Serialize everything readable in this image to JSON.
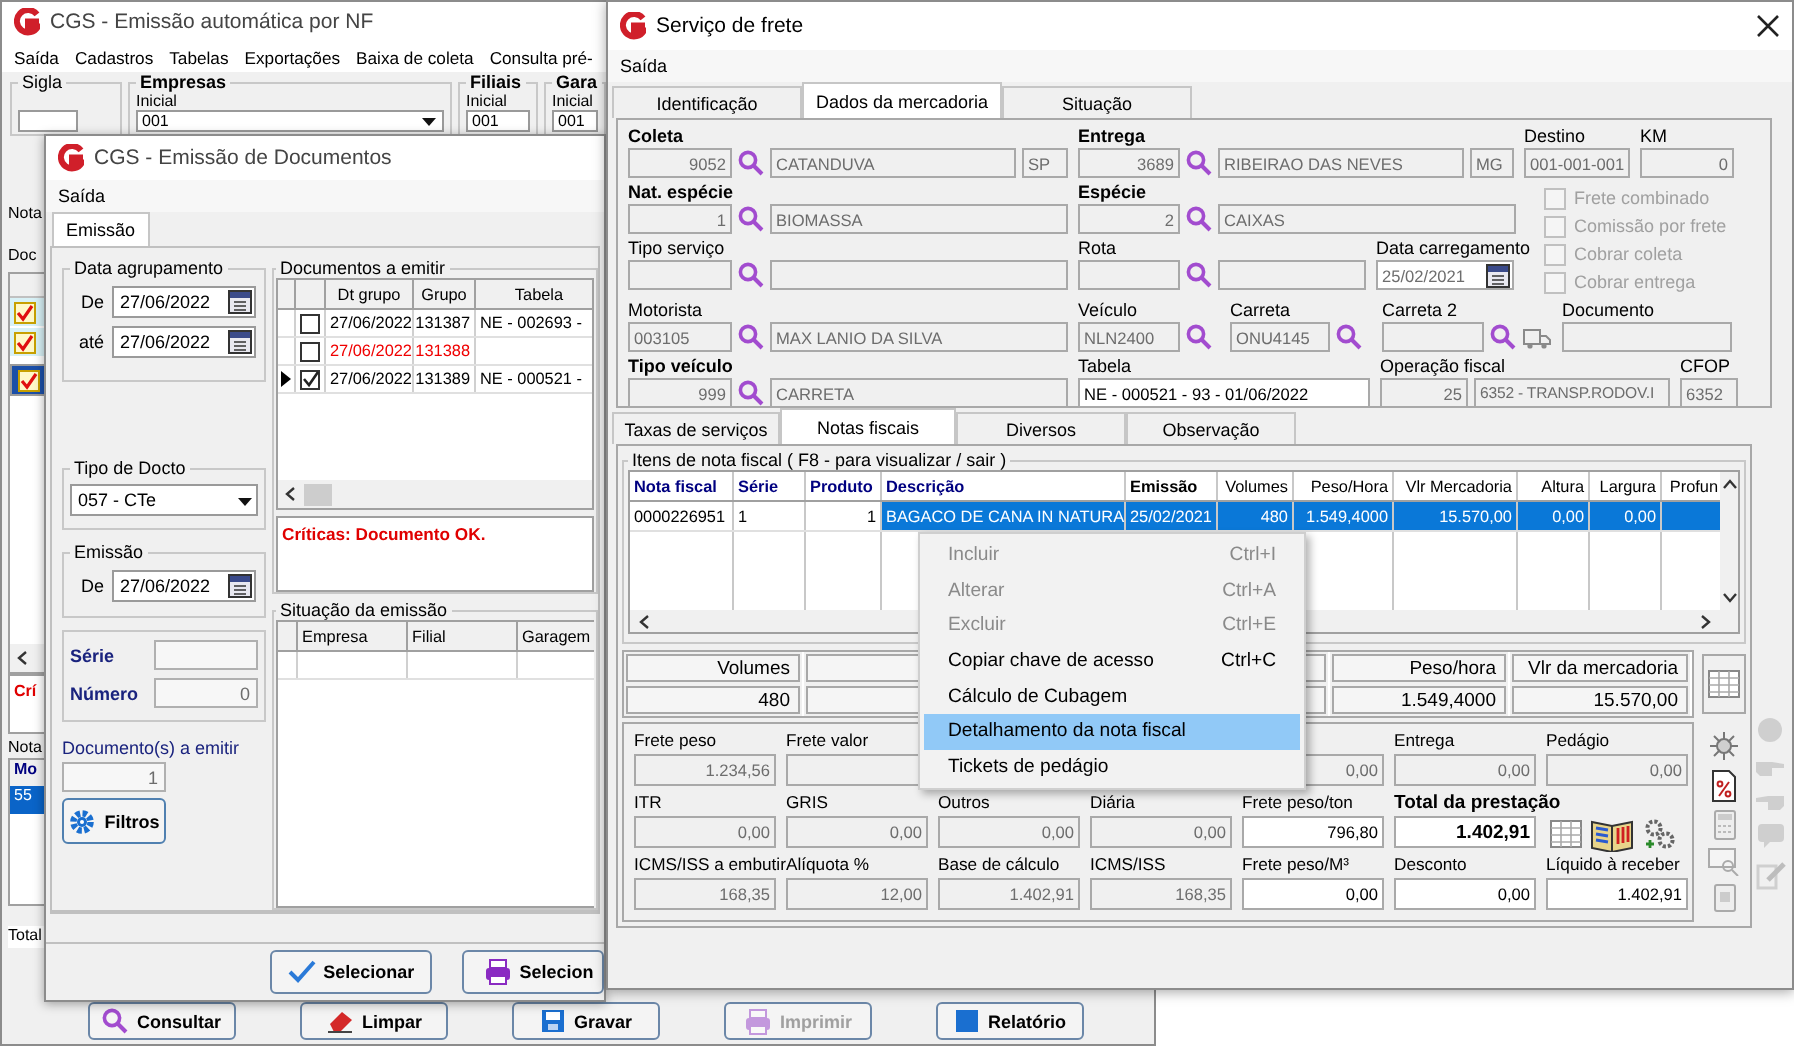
{
  "back_window": {
    "title": "CGS - Emissão automática por NF",
    "menu": [
      "Saída",
      "Cadastros",
      "Tabelas",
      "Exportações",
      "Baixa de coleta",
      "Consulta pré-"
    ],
    "filters": [
      {
        "label": "Sigla",
        "kind": "plain"
      },
      {
        "label": "Empresas",
        "kind": "select",
        "sublabel": "Inicial",
        "value": "001"
      },
      {
        "label": "Filiais",
        "kind": "text",
        "sublabel": "Inicial",
        "value": "001"
      },
      {
        "label": "Gara",
        "kind": "text",
        "sublabel": "Inicial",
        "value": "001"
      }
    ],
    "tab": "Nota",
    "grid_title": "Doc",
    "checks": [
      {
        "checked": true,
        "selected": false
      },
      {
        "checked": true,
        "selected": false
      },
      {
        "checked": true,
        "selected": true
      }
    ],
    "criticas": "Crí",
    "notes_title": "Nota",
    "notes_header": "Mo",
    "notes_cell": "55",
    "total_label": "Total",
    "buttons": [
      {
        "label": "Consultar",
        "disabled": false
      },
      {
        "label": "Limpar",
        "disabled": false
      },
      {
        "label": "Gravar",
        "disabled": false
      },
      {
        "label": "Imprimir",
        "disabled": true
      },
      {
        "label": "Relatório",
        "disabled": false
      }
    ]
  },
  "documents_window": {
    "title": "CGS - Emissão de Documentos",
    "menu": [
      "Saída"
    ],
    "tabs": [
      {
        "label": "Emissão",
        "selected": true
      }
    ],
    "date_group": {
      "title": "Data agrupamento",
      "from_label": "De",
      "from": "27/06/2022",
      "to_label": "até",
      "to": "27/06/2022"
    },
    "doc_type": {
      "title": "Tipo de Docto",
      "value": "057 - CTe"
    },
    "emission": {
      "title": "Emissão",
      "from_label": "De",
      "from": "27/06/2022"
    },
    "serie_label": "Série",
    "numero_label": "Número",
    "numero": "0",
    "count_label": "Documento(s) a emitir",
    "count": "1",
    "filters_button": "Filtros",
    "docs": {
      "title": "Documentos a emitir",
      "columns": [
        "Dt grupo",
        "Grupo",
        "Tabela"
      ],
      "rows": [
        {
          "checked": false,
          "current": false,
          "error": false,
          "cells": [
            "27/06/2022",
            "131387",
            "NE - 002693 -"
          ]
        },
        {
          "checked": false,
          "current": false,
          "error": true,
          "cells": [
            "27/06/2022",
            "131388",
            ""
          ]
        },
        {
          "checked": true,
          "current": true,
          "error": false,
          "cells": [
            "27/06/2022",
            "131389",
            "NE - 000521 -"
          ]
        }
      ]
    },
    "criticas": "Críticas: Documento OK.",
    "status": {
      "title": "Situação da emissão",
      "columns": [
        "Empresa",
        "Filial",
        "Garagem"
      ]
    },
    "buttons": [
      "Selecionar",
      "Selecion"
    ]
  },
  "freight_window": {
    "title": "Serviço de frete",
    "menu": [
      "Saída"
    ],
    "tabs": [
      {
        "label": "Identificação",
        "selected": false
      },
      {
        "label": "Dados da mercadoria",
        "selected": true
      },
      {
        "label": "Situação",
        "selected": false
      }
    ],
    "form": [
      [
        {
          "label": "Coleta",
          "bold": true,
          "parts": [
            {
              "kind": "code",
              "value": "9052"
            },
            {
              "kind": "lookup"
            },
            {
              "kind": "text",
              "value": "CATANDUVA"
            },
            {
              "kind": "text",
              "value": "SP"
            }
          ]
        },
        {
          "label": "Entrega",
          "bold": true,
          "parts": [
            {
              "kind": "code",
              "value": "3689"
            },
            {
              "kind": "lookup"
            },
            {
              "kind": "text",
              "value": "RIBEIRAO DAS NEVES"
            },
            {
              "kind": "text",
              "value": "MG"
            }
          ]
        },
        {
          "label": "Destino",
          "bold": false,
          "parts": [
            {
              "kind": "text",
              "value": "001-001-001"
            }
          ]
        },
        {
          "label": "KM",
          "bold": false,
          "parts": [
            {
              "kind": "code",
              "value": "0"
            }
          ]
        }
      ],
      [
        {
          "label": "Nat. espécie",
          "bold": true,
          "parts": [
            {
              "kind": "code",
              "value": "1"
            },
            {
              "kind": "lookup"
            },
            {
              "kind": "text",
              "value": "BIOMASSA"
            }
          ]
        },
        {
          "label": "Espécie",
          "bold": true,
          "parts": [
            {
              "kind": "code",
              "value": "2"
            },
            {
              "kind": "lookup"
            },
            {
              "kind": "text",
              "value": "CAIXAS"
            }
          ]
        }
      ],
      [
        {
          "label": "Tipo serviço",
          "bold": false,
          "parts": [
            {
              "kind": "code"
            },
            {
              "kind": "lookup"
            },
            {
              "kind": "text"
            }
          ]
        },
        {
          "label": "Rota",
          "bold": false,
          "parts": [
            {
              "kind": "code"
            },
            {
              "kind": "lookup"
            },
            {
              "kind": "text"
            }
          ]
        },
        {
          "label": "Data carregamento",
          "bold": false,
          "parts": [
            {
              "kind": "date",
              "value": "25/02/2021"
            }
          ]
        }
      ],
      [
        {
          "label": "Motorista",
          "bold": false,
          "parts": [
            {
              "kind": "text",
              "value": "003105"
            },
            {
              "kind": "lookup"
            },
            {
              "kind": "text",
              "value": "MAX LANIO DA SILVA"
            }
          ]
        },
        {
          "label": "Veículo",
          "bold": false,
          "parts": [
            {
              "kind": "text",
              "value": "NLN2400"
            },
            {
              "kind": "lookup"
            }
          ]
        },
        {
          "label": "Carreta",
          "bold": false,
          "parts": [
            {
              "kind": "text",
              "value": "ONU4145"
            },
            {
              "kind": "lookup"
            }
          ]
        },
        {
          "label": "Carreta 2",
          "bold": false,
          "parts": [
            {
              "kind": "text"
            },
            {
              "kind": "lookup"
            },
            {
              "kind": "truck"
            }
          ]
        },
        {
          "label": "Documento",
          "bold": false,
          "parts": [
            {
              "kind": "text"
            }
          ]
        }
      ],
      [
        {
          "label": "Tipo veículo",
          "bold": true,
          "parts": [
            {
              "kind": "code",
              "value": "999"
            },
            {
              "kind": "lookup"
            },
            {
              "kind": "text",
              "value": "CARRETA"
            }
          ]
        },
        {
          "label": "Tabela",
          "bold": false,
          "parts": [
            {
              "kind": "active",
              "value": "NE - 000521 - 93 - 01/06/2022"
            }
          ]
        },
        {
          "label": "Operação fiscal",
          "bold": false,
          "parts": [
            {
              "kind": "code",
              "value": "25"
            },
            {
              "kind": "text",
              "value": "6352 - TRANSP.RODOV.I"
            }
          ]
        },
        {
          "label": "CFOP",
          "bold": false,
          "parts": [
            {
              "kind": "text",
              "value": "6352"
            }
          ]
        }
      ]
    ],
    "options": [
      {
        "label": "Frete combinado",
        "checked": false,
        "disabled": true
      },
      {
        "label": "Comissão por frete",
        "checked": false,
        "disabled": true
      },
      {
        "label": "Cobrar coleta",
        "checked": false,
        "disabled": true
      },
      {
        "label": "Cobrar entrega",
        "checked": false,
        "disabled": true
      }
    ],
    "subtabs": [
      {
        "label": "Taxas de serviços",
        "selected": false
      },
      {
        "label": "Notas fiscais",
        "selected": true
      },
      {
        "label": "Diversos",
        "selected": false
      },
      {
        "label": "Observação",
        "selected": false
      }
    ],
    "items_title": "Itens de nota fiscal ( F8 - para visualizar / sair )",
    "columns": [
      {
        "label": "Nota fiscal",
        "kind": "key"
      },
      {
        "label": "Série",
        "kind": "key"
      },
      {
        "label": "Produto",
        "kind": "key"
      },
      {
        "label": "Descrição",
        "kind": "key"
      },
      {
        "label": "Emissão",
        "kind": "bold"
      },
      {
        "label": "Volumes",
        "kind": "plain"
      },
      {
        "label": "Peso/Hora",
        "kind": "plain"
      },
      {
        "label": "Vlr Mercadoria",
        "kind": "plain"
      },
      {
        "label": "Altura",
        "kind": "plain"
      },
      {
        "label": "Largura",
        "kind": "plain"
      },
      {
        "label": "Profun",
        "kind": "plain"
      }
    ],
    "rows": [
      {
        "selected": true,
        "cells": [
          "0000226951",
          "1",
          "1",
          "BAGACO DE CANA IN NATURA",
          "25/02/2021",
          "480",
          "1.549,4000",
          "15.570,00",
          "0,00",
          "0,00",
          ""
        ]
      }
    ],
    "context_menu": [
      {
        "label": "Incluir",
        "shortcut": "Ctrl+I",
        "disabled": true,
        "selected": false
      },
      {
        "label": "Alterar",
        "shortcut": "Ctrl+A",
        "disabled": true,
        "selected": false
      },
      {
        "label": "Excluir",
        "shortcut": "Ctrl+E",
        "disabled": true,
        "selected": false
      },
      {
        "label": "Copiar chave de acesso",
        "shortcut": "Ctrl+C",
        "disabled": false,
        "selected": false
      },
      {
        "label": "Cálculo de Cubagem",
        "disabled": false,
        "selected": false
      },
      {
        "label": "Detalhamento da nota fiscal",
        "disabled": false,
        "selected": true
      },
      {
        "label": "Tickets de pedágio",
        "disabled": false,
        "selected": false
      }
    ],
    "totals": [
      {
        "label": "Volumes",
        "value": "480"
      },
      {
        "label": "Peso/hora",
        "value": "1.549,4000"
      },
      {
        "label": "Vlr da mercadoria",
        "value": "15.570,00"
      }
    ],
    "fields": [
      [
        {
          "label": "Frete peso",
          "value": "1.234,56",
          "disabled": true,
          "bold": false
        },
        {
          "label": "Frete valor",
          "disabled": true,
          "bold": false
        },
        {
          "value": "0,00",
          "disabled": true,
          "bold": false
        },
        {
          "label": "Entrega",
          "value": "0,00",
          "disabled": true,
          "bold": false
        },
        {
          "label": "Pedágio",
          "value": "0,00",
          "disabled": true,
          "bold": false
        }
      ],
      [
        {
          "label": "ITR",
          "value": "0,00",
          "disabled": true,
          "bold": false
        },
        {
          "label": "GRIS",
          "value": "0,00",
          "disabled": true,
          "bold": false
        },
        {
          "label": "Outros",
          "value": "0,00",
          "disabled": true,
          "bold": false
        },
        {
          "label": "Diária",
          "value": "0,00",
          "disabled": true,
          "bold": false
        },
        {
          "label": "Frete peso/ton",
          "value": "796,80",
          "disabled": false,
          "bold": false
        },
        {
          "label": "Total da prestação",
          "value": "1.402,91",
          "disabled": false,
          "bold": true
        }
      ],
      [
        {
          "label": "ICMS/ISS a embutir",
          "value": "168,35",
          "disabled": true,
          "bold": false
        },
        {
          "label": "Alíquota %",
          "value": "12,00",
          "disabled": true,
          "bold": false
        },
        {
          "label": "Base de cálculo",
          "value": "1.402,91",
          "disabled": true,
          "bold": false
        },
        {
          "label": "ICMS/ISS",
          "value": "168,35",
          "disabled": true,
          "bold": false
        },
        {
          "label": "Frete peso/M³",
          "value": "0,00",
          "disabled": false,
          "bold": false
        },
        {
          "label": "Desconto",
          "value": "0,00",
          "disabled": false,
          "bold": false
        },
        {
          "label": "Líquido à receber",
          "value": "1.402,91",
          "disabled": false,
          "bold": false
        }
      ]
    ]
  }
}
